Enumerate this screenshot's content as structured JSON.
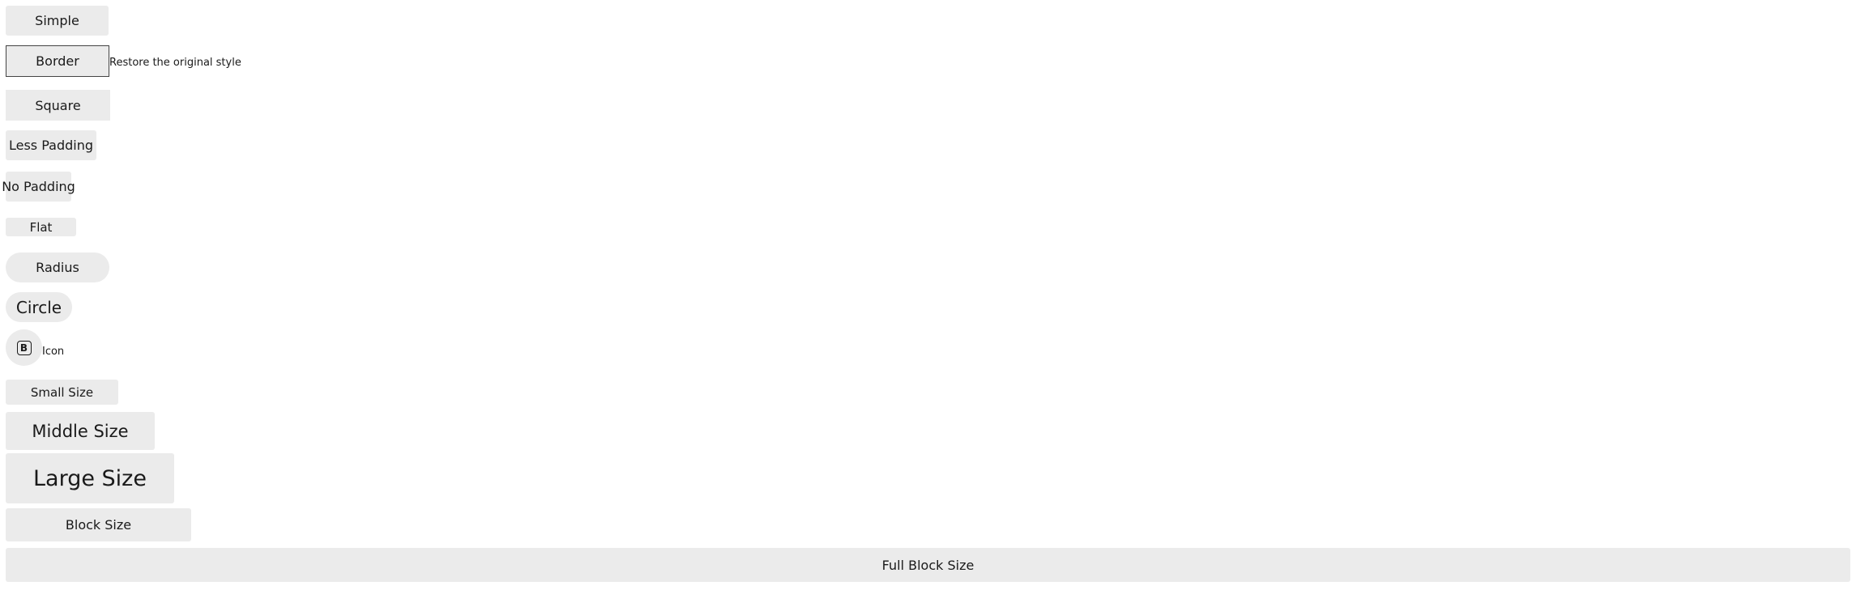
{
  "buttons": {
    "simple": "Simple",
    "border": "Border",
    "square": "Square",
    "less_padding": "Less Padding",
    "no_padding": "No Padding",
    "flat": "Flat",
    "radius": "Radius",
    "circle": "Circle",
    "icon_glyph": "B",
    "small_size": "Small Size",
    "middle_size": "Middle Size",
    "large_size": "Large Size",
    "block_size": "Block Size",
    "full_block_size": "Full Block Size"
  },
  "notes": {
    "border_note": "Restore the original style",
    "icon_note": "Icon"
  },
  "icons": {
    "icon_button": "bold-b-icon"
  },
  "colors": {
    "button_bg": "#ebebeb",
    "text": "#1a1a1a",
    "border": "#444444"
  }
}
